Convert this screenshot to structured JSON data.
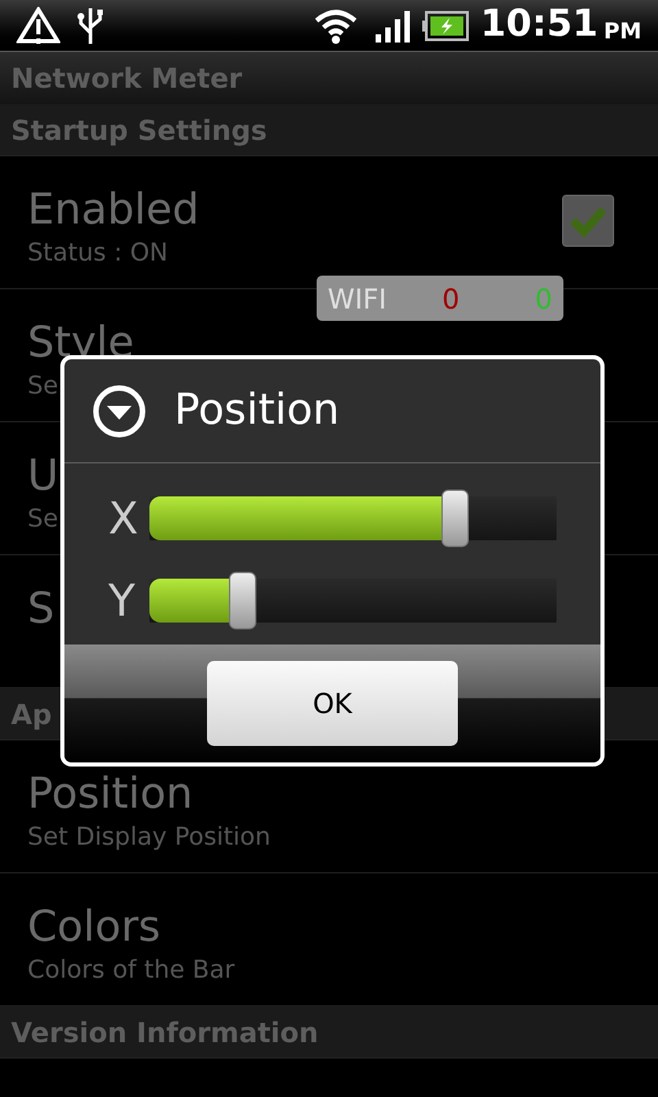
{
  "status_bar": {
    "time": "10:51",
    "ampm": "PM"
  },
  "title": "Network Meter",
  "items": [
    {
      "kind": "header",
      "text": "Startup Settings"
    },
    {
      "kind": "pref",
      "title": "Enabled",
      "summary": "Status : ON",
      "checked": true
    },
    {
      "kind": "pref",
      "title": "Style",
      "summary": "Se"
    },
    {
      "kind": "pref",
      "title": "U",
      "summary": "Se"
    },
    {
      "kind": "pref",
      "title": "S"
    },
    {
      "kind": "header",
      "text": "Ap"
    },
    {
      "kind": "pref",
      "title": "Position",
      "summary": "Set Display Position"
    },
    {
      "kind": "pref",
      "title": "Colors",
      "summary": "Colors of the Bar"
    },
    {
      "kind": "header",
      "text": "Version Information"
    }
  ],
  "meter_overlay": {
    "label": "WIFI",
    "rx": "0",
    "tx": "0"
  },
  "dialog": {
    "title": "Position",
    "sliders": [
      {
        "label": "X",
        "level": 0.75
      },
      {
        "label": "Y",
        "level": 0.23
      }
    ],
    "buttons": [
      "OK"
    ]
  }
}
